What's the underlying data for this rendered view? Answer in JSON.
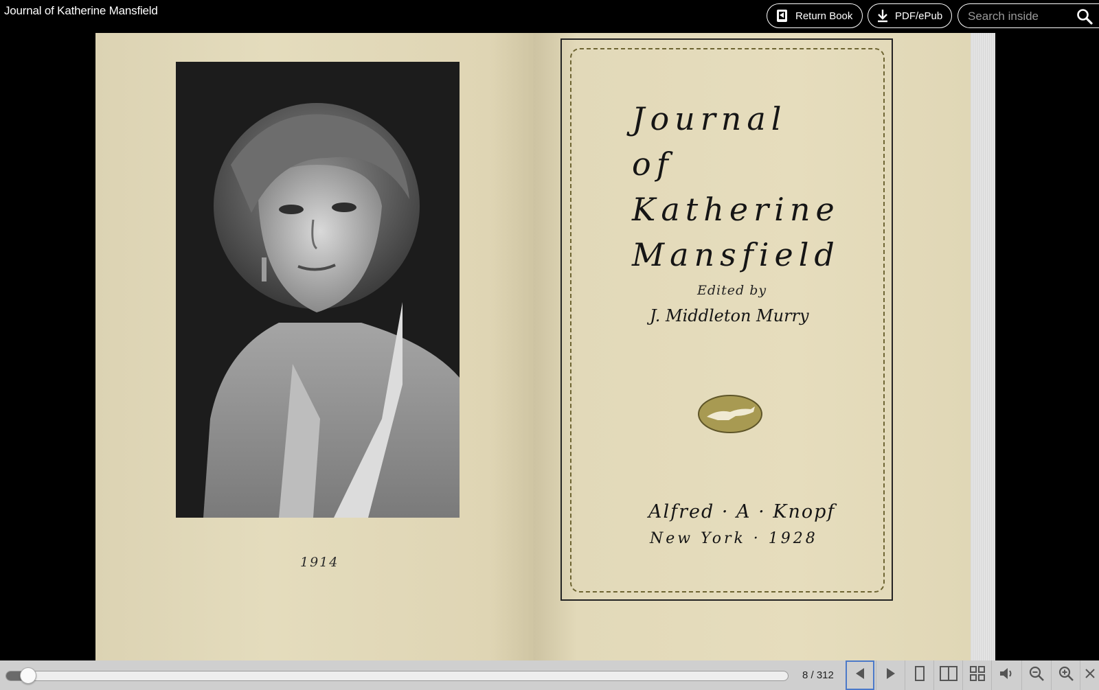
{
  "header": {
    "title": "Journal of Katherine Mansfield",
    "return_book_label": "Return Book",
    "pdf_label": "PDF/ePub",
    "search_placeholder": "Search inside"
  },
  "book": {
    "left_page": {
      "caption": "1914"
    },
    "right_page": {
      "title": "Journal of\nKatherine\nMansfield",
      "edited_by": "Edited by",
      "editor": "J. Middleton Murry",
      "publisher": "Alfred · A · Knopf",
      "place_year": "New York · 1928"
    }
  },
  "footer": {
    "page_indicator": "8 / 312",
    "progress_fraction": 0.0256,
    "buttons": [
      "prev-icon",
      "next-icon",
      "one-page-icon",
      "two-page-icon",
      "thumbnail-grid-icon",
      "read-aloud-icon",
      "zoom-out-icon",
      "zoom-in-icon",
      "close-icon"
    ]
  },
  "colors": {
    "page": "#e2d9b9",
    "toolbar": "#cfcfcf",
    "active_outline": "#4b79c9"
  }
}
